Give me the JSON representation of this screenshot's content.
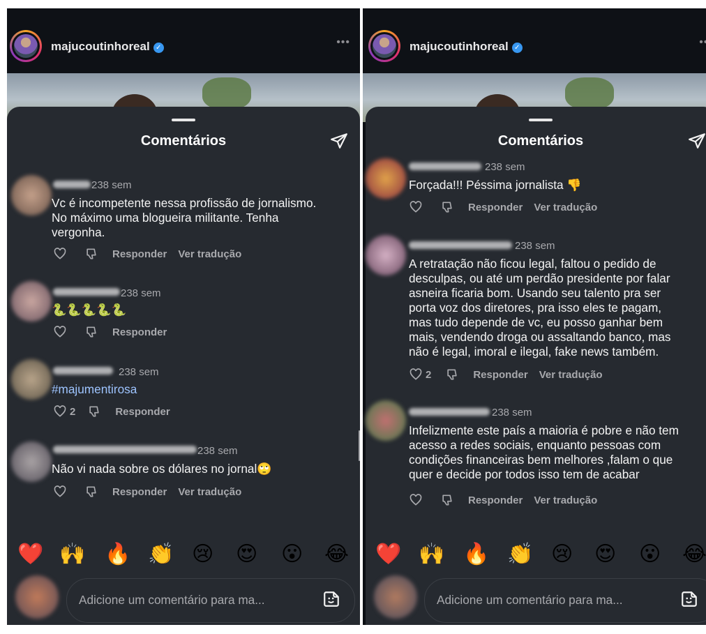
{
  "panels": [
    {
      "username": "majucoutinhoreal",
      "sheet_title": "Comentários",
      "comments": [
        {
          "time": "238 sem",
          "text": "Vc é incompetente nessa profissão de jornalismo.\nNo máximo uma blogueira militante. Tenha\nvergonha.",
          "likes": "",
          "reply": "Responder",
          "translate": "Ver tradução"
        },
        {
          "time": "238 sem",
          "text": "🐍🐍🐍🐍🐍",
          "likes": "",
          "reply": "Responder",
          "translate": ""
        },
        {
          "time": "238 sem",
          "text": "#majumentirosa",
          "likes": "2",
          "reply": "Responder",
          "translate": ""
        },
        {
          "time": "238 sem",
          "text": "Não vi nada sobre os dólares  no jornal🙄",
          "likes": "",
          "reply": "Responder",
          "translate": "Ver tradução"
        }
      ],
      "emojis": [
        "❤️",
        "🙌",
        "🔥",
        "👏",
        "😢",
        "😍",
        "😮",
        "😂"
      ],
      "input_placeholder": "Adicione um comentário para ma..."
    },
    {
      "username": "majucoutinhoreal",
      "sheet_title": "Comentários",
      "comments": [
        {
          "time": "238 sem",
          "text": "Forçada!!! Péssima jornalista 👎",
          "likes": "",
          "reply": "Responder",
          "translate": "Ver tradução"
        },
        {
          "time": "238 sem",
          "text": "A retratação não ficou legal, faltou o pedido de\ndesculpas, ou até um perdão presidente por falar\nasneira ficaria bom. Usando seu talento pra ser\nporta voz dos diretores, pra isso eles te pagam,\nmas tudo depende de vc, eu posso ganhar bem\nmais, vendendo droga ou  assaltando banco, mas\nnão é legal, imoral e ilegal, fake news também.",
          "likes": "2",
          "reply": "Responder",
          "translate": "Ver tradução"
        },
        {
          "time": "238 sem",
          "text": "Infelizmente este país a maioria é pobre e não tem\nacesso a redes sociais, enquanto pessoas com\ncondições financeiras bem melhores ,falam o que\nquer e decide por todos isso tem de acabar",
          "likes": "",
          "reply": "Responder",
          "translate": "Ver tradução"
        }
      ],
      "emojis": [
        "❤️",
        "🙌",
        "🔥",
        "👏",
        "😢",
        "😍",
        "😮",
        "😂"
      ],
      "input_placeholder": "Adicione um comentário para ma..."
    }
  ],
  "colors": {
    "sheet_bg": "#262a30",
    "top_bg": "#0e1116",
    "muted": "#a8a9ad",
    "hashtag": "#9ec4ff",
    "verified": "#3897f0"
  },
  "icons": {
    "share": "paper-plane-icon",
    "like": "heart-icon",
    "dislike": "dislike-icon",
    "sticker": "sticker-icon",
    "more": "more-icon",
    "verified": "verified-badge-icon"
  }
}
